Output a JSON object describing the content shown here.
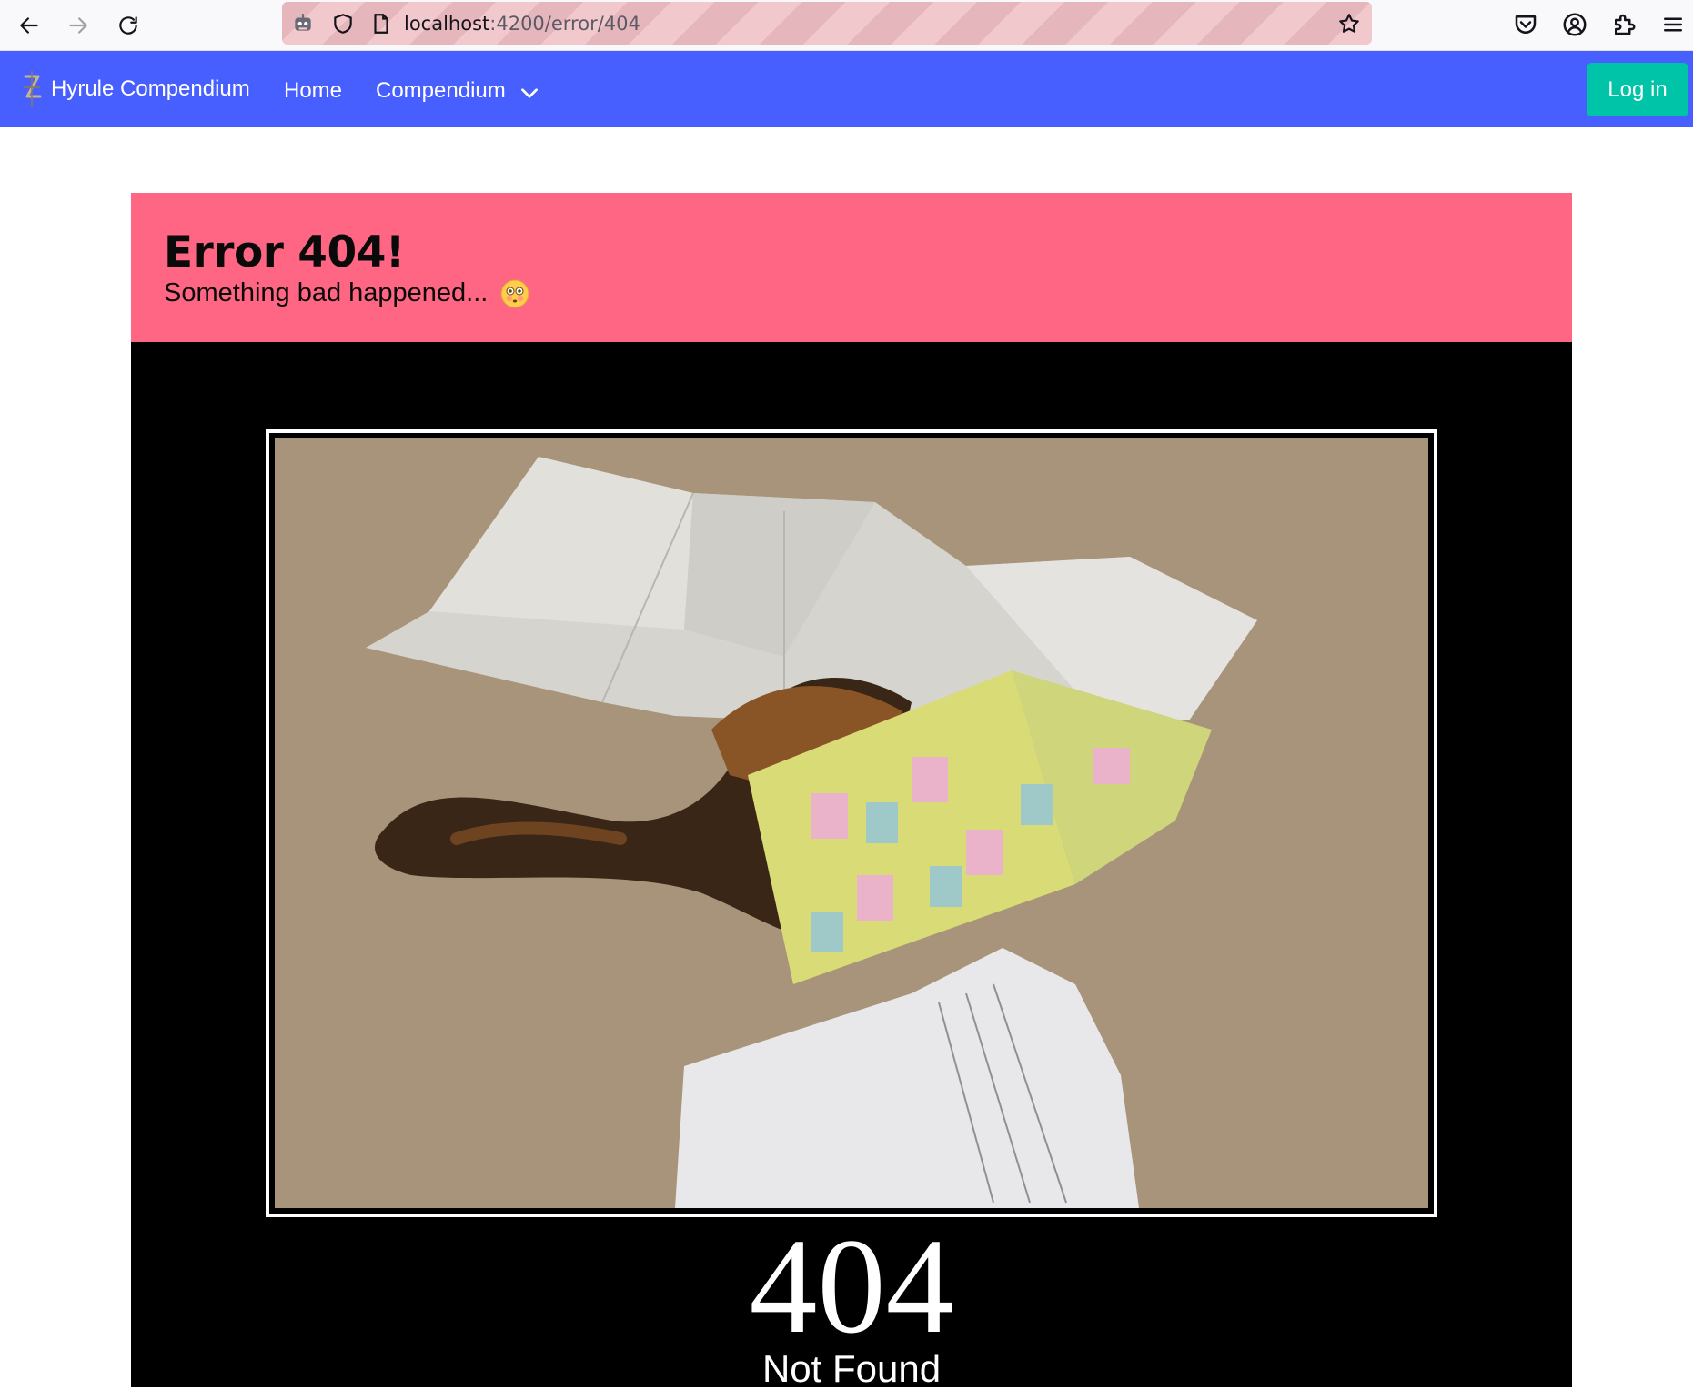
{
  "browser": {
    "url_host": "localhost",
    "url_path": ":4200/error/404"
  },
  "navbar": {
    "brand": "Hyrule Compendium",
    "links": [
      "Home",
      "Compendium"
    ],
    "login_label": "Log in",
    "color": "#485fff",
    "login_color": "#00c4a7"
  },
  "error": {
    "title": "Error 404!",
    "subtitle": "Something bad happened...",
    "banner_color": "#ff6683"
  },
  "poster": {
    "number": "404",
    "caption": "Not Found"
  },
  "icons": {
    "back": "back-arrow-icon",
    "forward": "forward-arrow-icon",
    "reload": "reload-icon",
    "emoji": "flushed-face-emoji"
  }
}
